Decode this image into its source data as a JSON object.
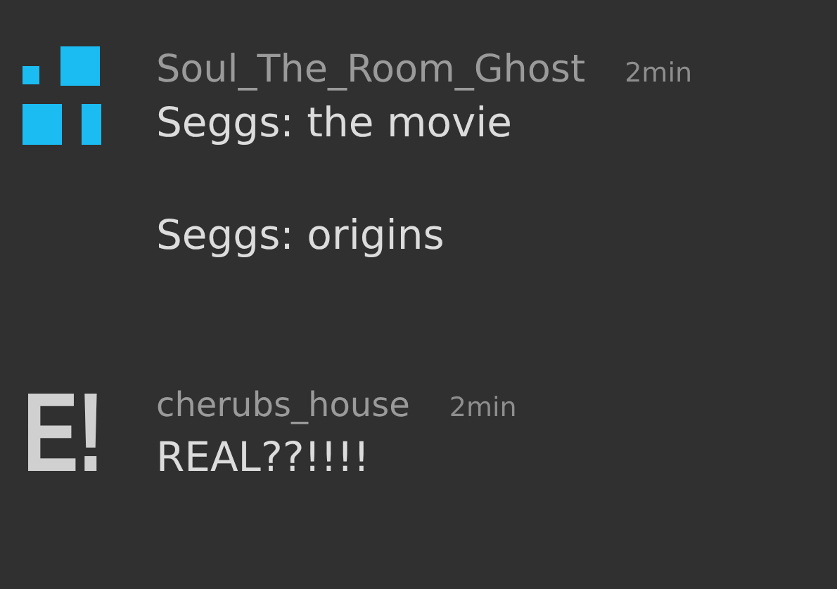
{
  "messages": [
    {
      "author": "Soul_The_Room_Ghost",
      "time": "2min",
      "avatar": {
        "kind": "blocks"
      },
      "lines": [
        "Seggs: the movie",
        "Seggs: origins"
      ]
    },
    {
      "author": "cherubs_house",
      "time": "2min",
      "avatar": {
        "kind": "letters",
        "text": "E!"
      },
      "lines": [
        "REAL??!!!!"
      ]
    }
  ]
}
